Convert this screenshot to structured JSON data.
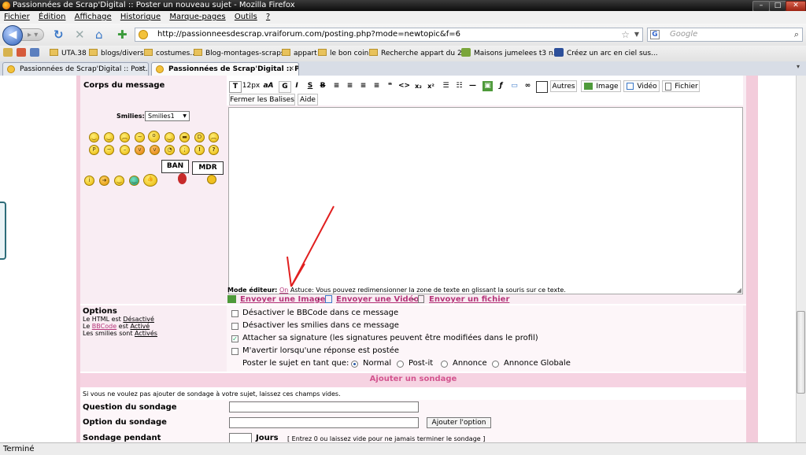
{
  "window": {
    "title": "Passionnées de Scrap'Digital :: Poster un nouveau sujet - Mozilla Firefox"
  },
  "menu": [
    "Fichier",
    "Édition",
    "Affichage",
    "Historique",
    "Marque-pages",
    "Outils",
    "?"
  ],
  "nav": {
    "url": "http://passionneesdescrap.vraiforum.com/posting.php?mode=newtopic&f=6",
    "search_placeholder": "Google"
  },
  "bookmarks": [
    "UTA.38",
    "blogs/divers",
    "costumes...",
    "Blog-montages-scraps",
    "appart",
    "le bon coin",
    "Recherche appart du 2...",
    "Maisons jumelees t3 n...",
    "Créez un arc en ciel sus..."
  ],
  "tabs": [
    {
      "label": "Passionnées de Scrap'Digital :: Post..."
    },
    {
      "label": "Passionnées de Scrap'Digital :: Po..."
    }
  ],
  "form": {
    "body_label": "Corps du message",
    "smilies_label": "Smilies:",
    "smilies_select": "Smilies1",
    "sign_ban": "BAN",
    "sign_mdr": "MDR",
    "toolbar": {
      "font_size": "12px",
      "font_size_icon": "aA",
      "autres": "Autres",
      "image": "Image",
      "video": "Vidéo",
      "fichier": "Fichier",
      "close_tags": "Fermer les Balises",
      "aide": "Aide"
    },
    "editor_mode_label": "Mode éditeur:",
    "editor_mode_value": "On",
    "tip": "Astuce: Vous pouvez redimensionner la zone de texte en glissant la souris sur ce texte.",
    "upload": {
      "image": "Envoyer une Image",
      "video": "Envoyer une Vidéo",
      "file": "Envoyer un fichier",
      "sep": "-"
    }
  },
  "options": {
    "title": "Options",
    "html_line_prefix": "Le HTML est",
    "html_state": "Désactivé",
    "bbcode_prefix": "Le",
    "bbcode_word": "BBCode",
    "bbcode_mid": "est",
    "bbcode_state": "Activé",
    "smilies_prefix": "Les smilies sont",
    "smilies_state": "Activés",
    "checkboxes": [
      {
        "label": "Désactiver le BBCode dans ce message",
        "checked": false
      },
      {
        "label": "Désactiver les smilies dans ce message",
        "checked": false
      },
      {
        "label": "Attacher sa signature (les signatures peuvent être modifiées dans le profil)",
        "checked": true
      },
      {
        "label": "M'avertir lorsqu'une réponse est postée",
        "checked": false
      }
    ],
    "post_as_label": "Poster le sujet en tant que:",
    "post_types": [
      {
        "label": "Normal",
        "selected": true
      },
      {
        "label": "Post-it",
        "selected": false
      },
      {
        "label": "Annonce",
        "selected": false
      },
      {
        "label": "Annonce Globale",
        "selected": false
      }
    ]
  },
  "poll": {
    "header": "Ajouter un sondage",
    "hint": "Si vous ne voulez pas ajouter de sondage à votre sujet, laissez ces champs vides.",
    "question_label": "Question du sondage",
    "option_label": "Option du sondage",
    "add_option": "Ajouter l'option",
    "duration_label": "Sondage pendant",
    "days": "Jours",
    "duration_hint": "[ Entrez 0 ou laissez vide pour ne jamais terminer le sondage ]"
  },
  "status": "Terminé",
  "colors": {
    "accent_pink": "#b5367a",
    "frame_pink": "#f3ccdb",
    "arrow_red": "#e11f1f"
  }
}
